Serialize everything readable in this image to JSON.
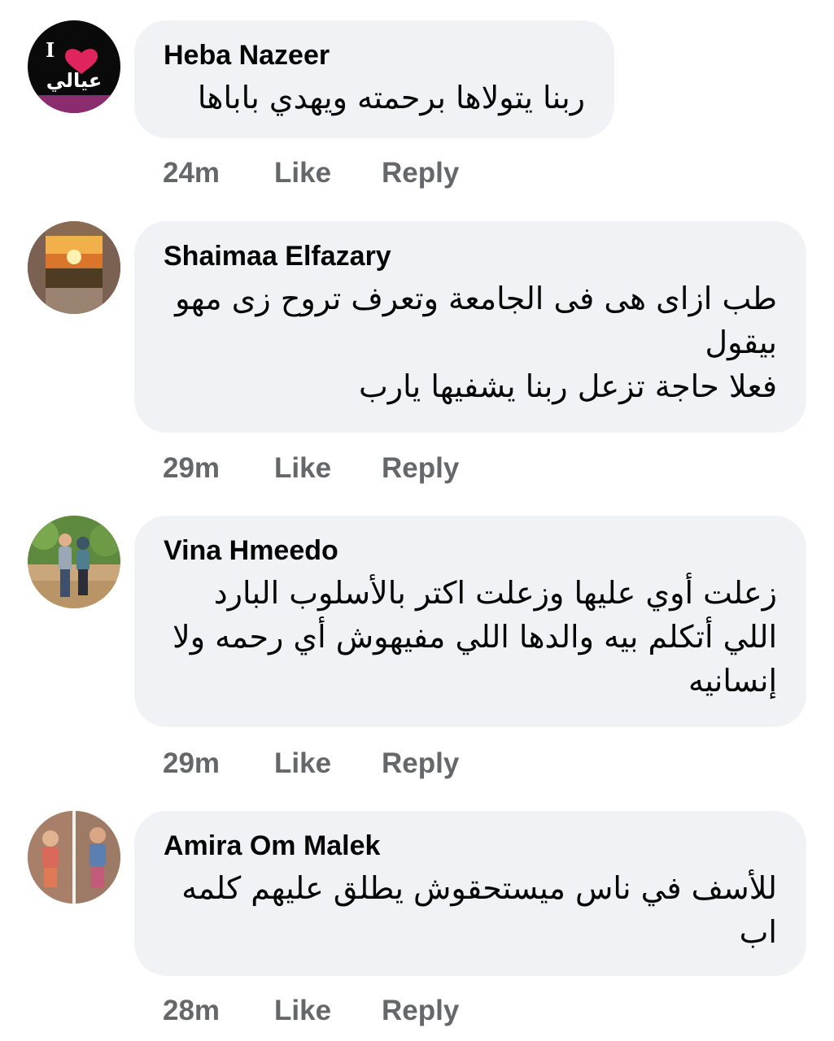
{
  "comments": [
    {
      "author": "Heba Nazeer",
      "text": "ربنا يتولاها برحمته ويهدي باباها",
      "time": "24m",
      "like_label": "Like",
      "reply_label": "Reply",
      "avatar": {
        "icon": "heart-icon",
        "caption_top": "I",
        "caption": "عيالي",
        "bg": "#0a0a0a",
        "accent": "#e0245e"
      }
    },
    {
      "author": "Shaimaa Elfazary",
      "text": "طب ازاى هى فى الجامعة وتعرف تروح زى مهو\nبيقول\nفعلا حاجة تزعل ربنا يشفيها يارب",
      "time": "29m",
      "like_label": "Like",
      "reply_label": "Reply",
      "avatar": {
        "icon": "sunset-photo",
        "bg": "#7a5a44"
      }
    },
    {
      "author": "Vina Hmeedo",
      "text": "زعلت أوي عليها وزعلت اكتر بالأسلوب البارد\nاللي أتكلم بيه والدها اللي مفيهوش أي رحمه ولا\nإنسانيه",
      "time": "29m",
      "like_label": "Like",
      "reply_label": "Reply",
      "avatar": {
        "icon": "couple-photo",
        "bg": "#6b8a4e"
      }
    },
    {
      "author": "Amira Om Malek",
      "text": "للأسف في ناس ميستحقوش يطلق عليهم كلمه\nاب",
      "time": "28m",
      "like_label": "Like",
      "reply_label": "Reply",
      "avatar": {
        "icon": "children-photo",
        "bg": "#b0785a"
      }
    }
  ]
}
